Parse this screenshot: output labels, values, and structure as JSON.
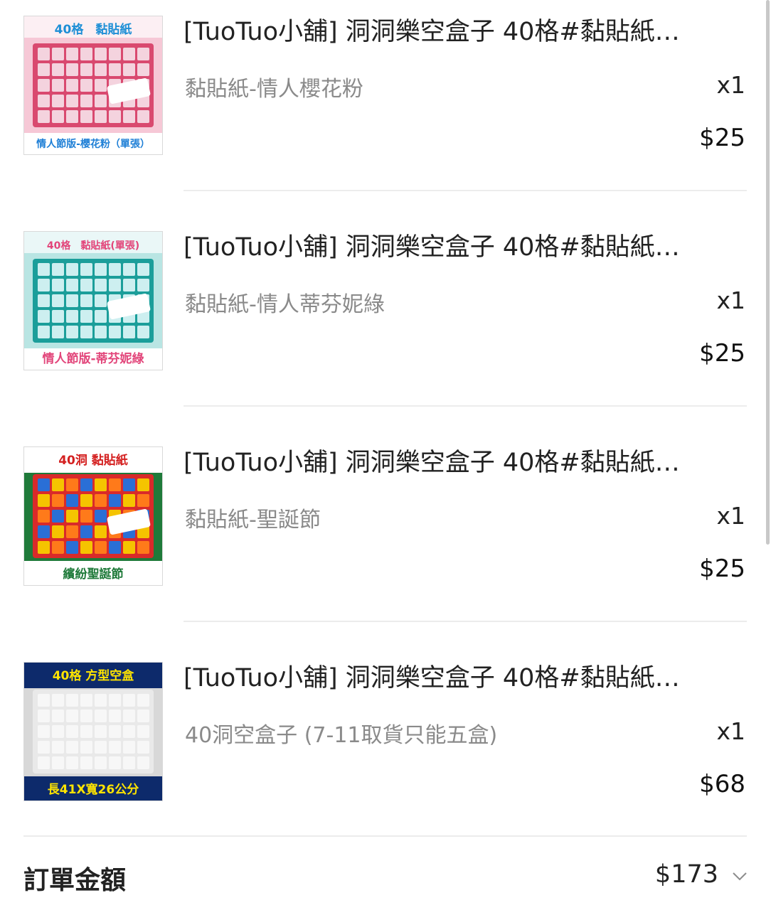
{
  "items": [
    {
      "title": "[TuoTuo小舖] 洞洞樂空盒子 40格#黏貼紙…",
      "variant": "黏貼紙-情人櫻花粉",
      "qty": "x1",
      "price": "$25",
      "thumb": {
        "top_text": "40格　黏貼紙",
        "bottom_text": "情人節版-櫻花粉（單張）",
        "theme": "pink",
        "bg": "#f6c8d6",
        "board": "#d9496f",
        "cell": "#f4d3de",
        "top_color": "#1e8fd6",
        "bottom_color": "#1e7fd6"
      }
    },
    {
      "title": "[TuoTuo小舖] 洞洞樂空盒子 40格#黏貼紙…",
      "variant": "黏貼紙-情人蒂芬妮綠",
      "qty": "x1",
      "price": "$25",
      "thumb": {
        "top_text": "40格　黏貼紙(單張)",
        "bottom_text": "情人節版-蒂芬妮綠",
        "theme": "teal",
        "bg": "#b9e5e3",
        "board": "#1b9e9a",
        "cell": "#cdeff0",
        "top_color": "#e2457a",
        "bottom_color": "#e2457a"
      }
    },
    {
      "title": "[TuoTuo小舖] 洞洞樂空盒子 40格#黏貼紙…",
      "variant": "黏貼紙-聖誕節",
      "qty": "x1",
      "price": "$25",
      "thumb": {
        "top_text": "40洞 黏貼紙",
        "bottom_text": "繽紛聖誕節",
        "theme": "xmas",
        "bg": "#1f7a3a",
        "board": "#d92a2a",
        "cell": "#f5c400",
        "top_color": "#d42020",
        "bottom_color": "#1f7a3a"
      }
    },
    {
      "title": "[TuoTuo小舖] 洞洞樂空盒子 40格#黏貼紙…",
      "variant": "40洞空盒子 (7-11取貨只能五盒)",
      "qty": "x1",
      "price": "$68",
      "thumb": {
        "top_text": "40格 方型空盒",
        "bottom_text": "長41X寬26公分",
        "theme": "box",
        "bg": "#d8d8d8",
        "board": "#e9e9e9",
        "cell": "#f7f7f7",
        "top_color": "#ffe400",
        "bottom_color": "#ffe400"
      }
    }
  ],
  "summary": {
    "label": "訂單金額",
    "total": "$173",
    "expand_icon": "chevron-down-icon"
  }
}
